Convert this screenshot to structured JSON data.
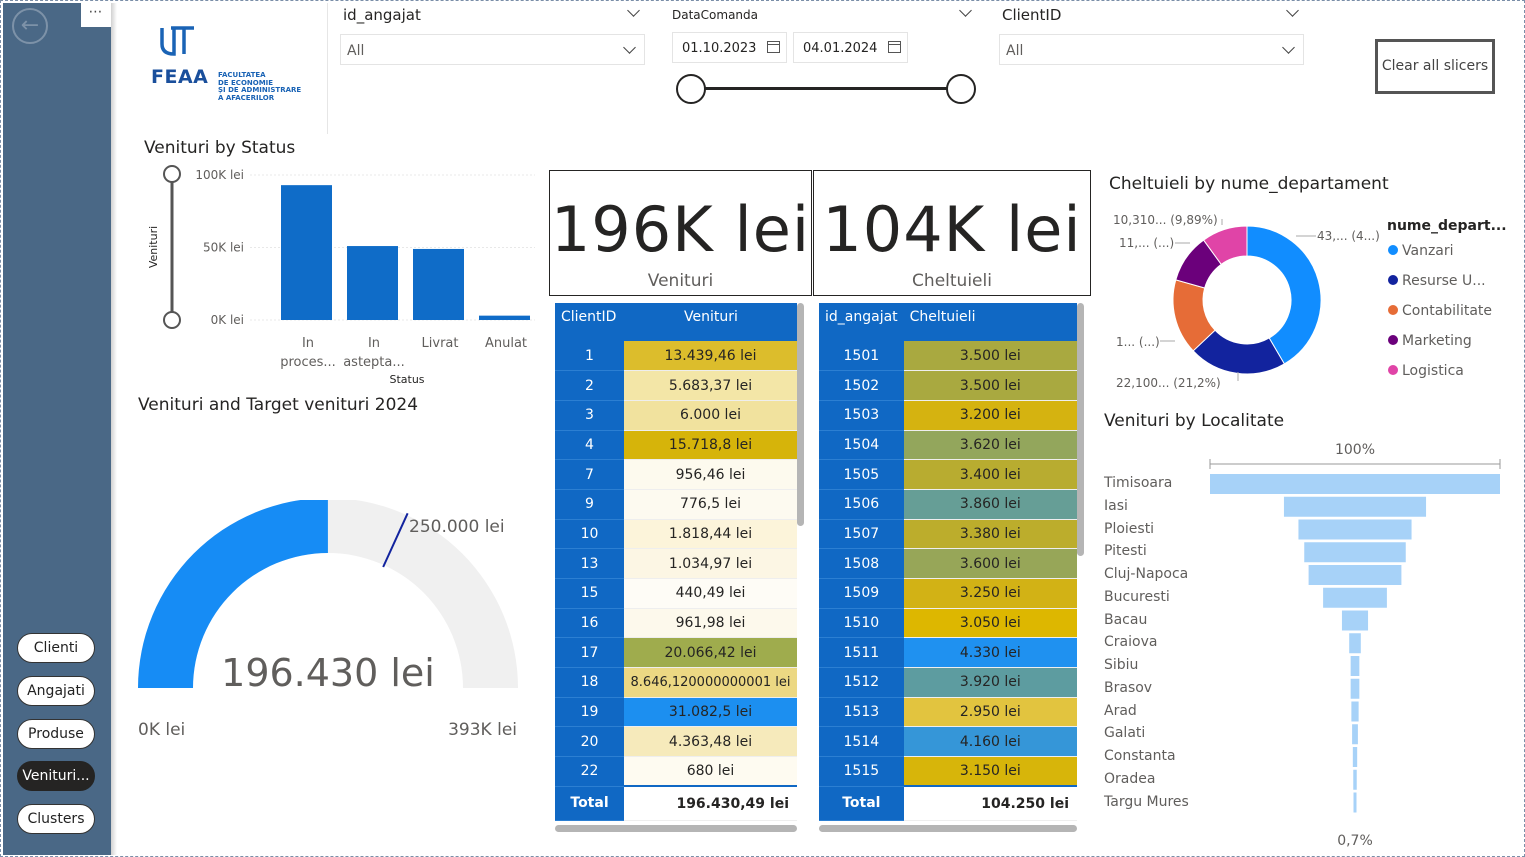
{
  "colors": {
    "nav": "#4a6886",
    "accent": "#1068c4",
    "bar": "#0f6cc8",
    "gauge_fill": "#168cf5",
    "gauge_bg": "#f0f0f0",
    "funnel": "#a7d2f8"
  },
  "nav": {
    "more_icon": "more-icon",
    "back_icon": "arrow-left-icon",
    "buttons": [
      {
        "label": "Clienti",
        "active": false
      },
      {
        "label": "Angajati",
        "active": false
      },
      {
        "label": "Produse",
        "active": false
      },
      {
        "label": "Venituri...",
        "active": true
      },
      {
        "label": "Clusters",
        "active": false
      }
    ]
  },
  "logo": {
    "mark": "UT",
    "abbr": "FEAA",
    "lines": [
      "FACULTATEA",
      "DE ECONOMIE",
      "ȘI DE ADMINISTRARE",
      "A AFACERILOR"
    ]
  },
  "slicers": {
    "angajat": {
      "title": "id_angajat",
      "value": "All"
    },
    "data": {
      "title": "DataComanda",
      "start": "01.10.2023",
      "end": "04.01.2024"
    },
    "client": {
      "title": "ClientID",
      "value": "All"
    },
    "clear_label": "Clear all slicers"
  },
  "status_chart_title": "Venituri by Status",
  "gauge_title": "Venituri and Target venituri 2024",
  "card_venituri": {
    "value": "196K lei",
    "label": "Venituri"
  },
  "card_cheltuieli": {
    "value": "104K lei",
    "label": "Cheltuieli"
  },
  "table_clients": {
    "headers": [
      "ClientID",
      "Venituri"
    ],
    "rows": [
      [
        "1",
        "13.439,46 lei",
        "#dcbd2c"
      ],
      [
        "2",
        "5.683,37 lei",
        "#f3e6a7"
      ],
      [
        "3",
        "6.000 lei",
        "#f1e29e"
      ],
      [
        "4",
        "15.718,8 lei",
        "#d6b40a"
      ],
      [
        "7",
        "956,46 lei",
        "#fdfaee"
      ],
      [
        "9",
        "776,5 lei",
        "#fdfaf0"
      ],
      [
        "10",
        "1.818,44 lei",
        "#fcf4da"
      ],
      [
        "13",
        "1.034,97 lei",
        "#fcf6e4"
      ],
      [
        "15",
        "440,49 lei",
        "#fefcf6"
      ],
      [
        "16",
        "961,98 lei",
        "#fdf9ec"
      ],
      [
        "17",
        "20.066,42 lei",
        "#9fac4d"
      ],
      [
        "18",
        "8.646,120000000001 lei",
        "#ecd883"
      ],
      [
        "19",
        "31.082,5 lei",
        "#1c8ff0"
      ],
      [
        "20",
        "4.363,48 lei",
        "#f6eabb"
      ],
      [
        "22",
        "680 lei",
        "#fefbf1"
      ]
    ],
    "total_label": "Total",
    "total_value": "196.430,49 lei"
  },
  "table_angajati": {
    "headers": [
      "id_angajat",
      "Cheltuieli"
    ],
    "rows": [
      [
        "1501",
        "3.500 lei",
        "#a9a940"
      ],
      [
        "1502",
        "3.500 lei",
        "#a9a940"
      ],
      [
        "1503",
        "3.200 lei",
        "#d5b310"
      ],
      [
        "1504",
        "3.620 lei",
        "#93a65c"
      ],
      [
        "1505",
        "3.400 lei",
        "#b8ac30"
      ],
      [
        "1506",
        "3.860 lei",
        "#669e96"
      ],
      [
        "1507",
        "3.380 lei",
        "#bcad2c"
      ],
      [
        "1508",
        "3.600 lei",
        "#97a658"
      ],
      [
        "1509",
        "3.250 lei",
        "#d2b215"
      ],
      [
        "1510",
        "3.050 lei",
        "#ddb700"
      ],
      [
        "1511",
        "4.330 lei",
        "#1f91f0"
      ],
      [
        "1512",
        "3.920 lei",
        "#5d9ca0"
      ],
      [
        "1513",
        "2.950 lei",
        "#e2c43f"
      ],
      [
        "1514",
        "4.160 lei",
        "#3596d8"
      ],
      [
        "1515",
        "3.150 lei",
        "#d7b50a"
      ]
    ],
    "total_label": "Total",
    "total_value": "104.250 lei"
  },
  "donut": {
    "title": "Cheltuieli by nume_departament",
    "legend_title": "nume_depart...",
    "items": [
      {
        "label": "Vanzari",
        "color": "#118dff"
      },
      {
        "label": "Resurse U...",
        "color": "#12239e"
      },
      {
        "label": "Contabilitate",
        "color": "#e66c37"
      },
      {
        "label": "Marketing",
        "color": "#6b007b"
      },
      {
        "label": "Logistica",
        "color": "#e044a7"
      }
    ],
    "labels": [
      "43,... (4...)",
      "22,100... (21,2%)",
      "1... (...)",
      "11,... (...)",
      "10,310... (9,89%)"
    ]
  },
  "funnel_title": "Veninturi by Localitate",
  "funnel_top_label": "100%",
  "funnel_bottom_label": "0,7%",
  "chart_data": [
    {
      "type": "bar",
      "title": "Venituri by Status",
      "xlabel": "Status",
      "ylabel": "Venituri",
      "categories": [
        "In proces...",
        "In astepta...",
        "Livrat",
        "Anulat"
      ],
      "values": [
        93000,
        51000,
        49000,
        3000
      ],
      "ylim": [
        0,
        100000
      ],
      "yticks": [
        "100K lei",
        "50K lei",
        "0K lei"
      ],
      "grid": true
    },
    {
      "type": "gauge",
      "title": "Venituri and Target venituri 2024",
      "value": 196430,
      "value_label": "196.430 lei",
      "min": 0,
      "min_label": "0K lei",
      "max": 393000,
      "max_label": "393K lei",
      "target": 250000,
      "target_label": "250.000 lei"
    },
    {
      "type": "pie",
      "title": "Cheltuieli by nume_departament",
      "categories": [
        "Vanzari",
        "Resurse U...",
        "Contabilitate",
        "Marketing",
        "Logistica"
      ],
      "values": [
        43,
        22.1,
        17,
        11,
        10.31
      ]
    },
    {
      "type": "bar",
      "title": "Venituri by Localitate",
      "categories": [
        "Timisoara",
        "Iasi",
        "Ploiesti",
        "Pitesti",
        "Cluj-Napoca",
        "Bucuresti",
        "Bacau",
        "Craiova",
        "Sibiu",
        "Brasov",
        "Arad",
        "Galati",
        "Constanta",
        "Oradea",
        "Targu Mures"
      ],
      "values": [
        100,
        49,
        39,
        35,
        32,
        22,
        9,
        4,
        3,
        3,
        2.5,
        2,
        1.5,
        1.2,
        0.7
      ]
    }
  ]
}
